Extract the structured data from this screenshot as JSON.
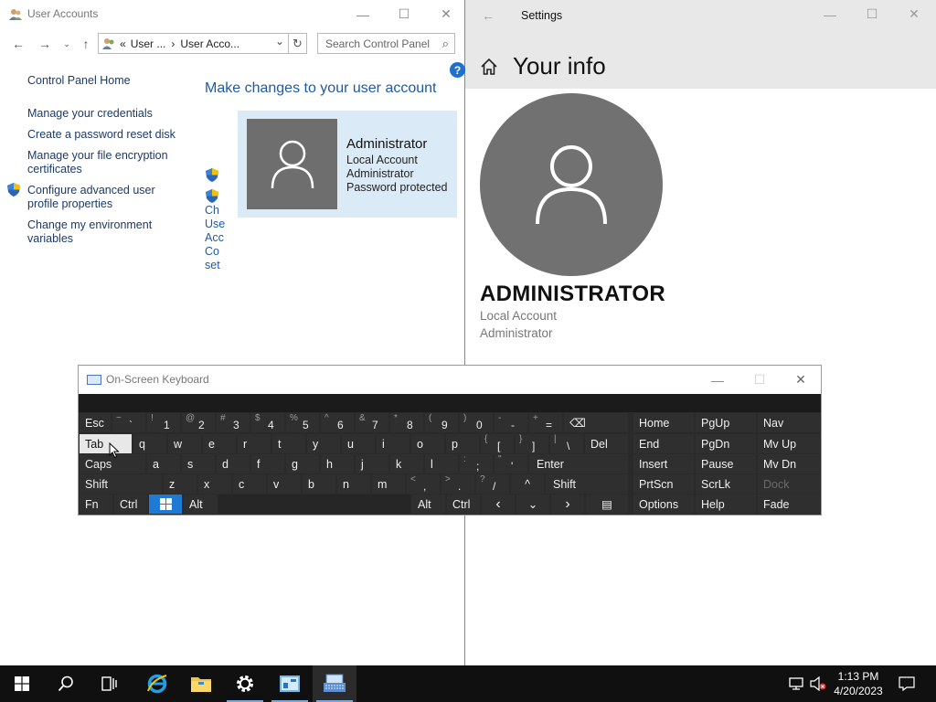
{
  "control_panel": {
    "window_title": "User Accounts",
    "address": {
      "prefix": "«",
      "crumb1": "User ...",
      "separator": "›",
      "crumb2": "User Acco..."
    },
    "search_placeholder": "Search Control Panel",
    "left_nav": {
      "home": "Control Panel Home",
      "manage_credentials": "Manage your credentials",
      "password_reset": "Create a password reset disk",
      "encryption_1": "Manage your file encryption",
      "encryption_2": "certificates",
      "advanced_1": "Configure advanced user",
      "advanced_2": "profile properties",
      "environment_1": "Change my environment",
      "environment_2": "variables"
    },
    "heading": "Make changes to your user account",
    "account": {
      "name": "Administrator",
      "type": "Local Account",
      "group": "Administrator",
      "status": "Password protected"
    },
    "truncated_links": [
      "Ch",
      "Use",
      "Acc",
      "Co",
      "set"
    ],
    "help_glyph": "?"
  },
  "settings": {
    "window_title": "Settings",
    "page_title": "Your info",
    "user_name": "ADMINISTRATOR",
    "account_type": "Local Account",
    "role": "Administrator"
  },
  "osk": {
    "window_title": "On-Screen Keyboard",
    "row1": {
      "esc": "Esc",
      "keys": [
        {
          "up": "~",
          "down": "`"
        },
        {
          "up": "!",
          "down": "1"
        },
        {
          "up": "@",
          "down": "2"
        },
        {
          "up": "#",
          "down": "3"
        },
        {
          "up": "$",
          "down": "4"
        },
        {
          "up": "%",
          "down": "5"
        },
        {
          "up": "^",
          "down": "6"
        },
        {
          "up": "&",
          "down": "7"
        },
        {
          "up": "*",
          "down": "8"
        },
        {
          "up": "(",
          "down": "9"
        },
        {
          "up": ")",
          "down": "0"
        },
        {
          "up": "-",
          "down": "-"
        },
        {
          "up": "+",
          "down": "="
        }
      ],
      "backspace": "⌫"
    },
    "row2": {
      "tab": "Tab",
      "letters": [
        "q",
        "w",
        "e",
        "r",
        "t",
        "y",
        "u",
        "i",
        "o",
        "p"
      ],
      "brackets": [
        {
          "up": "{",
          "down": "["
        },
        {
          "up": "}",
          "down": "]"
        },
        {
          "up": "|",
          "down": "\\"
        }
      ],
      "del": "Del"
    },
    "row3": {
      "caps": "Caps",
      "letters": [
        "a",
        "s",
        "d",
        "f",
        "g",
        "h",
        "j",
        "k",
        "l"
      ],
      "punct": [
        {
          "up": ":",
          "down": ";"
        },
        {
          "up": "\"",
          "down": "'"
        }
      ],
      "enter": "Enter"
    },
    "row4": {
      "shift_left": "Shift",
      "letters": [
        "z",
        "x",
        "c",
        "v",
        "b",
        "n",
        "m"
      ],
      "punct": [
        {
          "up": "<",
          "down": ","
        },
        {
          "up": ">",
          "down": "."
        },
        {
          "up": "?",
          "down": "/"
        }
      ],
      "up_arrow": "^",
      "shift_right": "Shift"
    },
    "row5": {
      "fn": "Fn",
      "ctrl_left": "Ctrl",
      "alt_left": "Alt",
      "alt_right": "Alt",
      "ctrl_right": "Ctrl",
      "left_arrow": "‹",
      "down_arrow": "⌄",
      "right_arrow": "›",
      "menu": "▤"
    },
    "nav_keys": [
      [
        "Home",
        "PgUp",
        "Nav"
      ],
      [
        "End",
        "PgDn",
        "Mv Up"
      ],
      [
        "Insert",
        "Pause",
        "Mv Dn"
      ],
      [
        "PrtScn",
        "ScrLk",
        "Dock"
      ],
      [
        "Options",
        "Help",
        "Fade"
      ]
    ]
  },
  "taskbar": {
    "time": "1:13 PM",
    "date": "4/20/2023",
    "pinned": [
      "windows-start",
      "search",
      "task-view",
      "internet-explorer",
      "file-explorer",
      "settings",
      "control-panel",
      "on-screen-keyboard"
    ]
  }
}
